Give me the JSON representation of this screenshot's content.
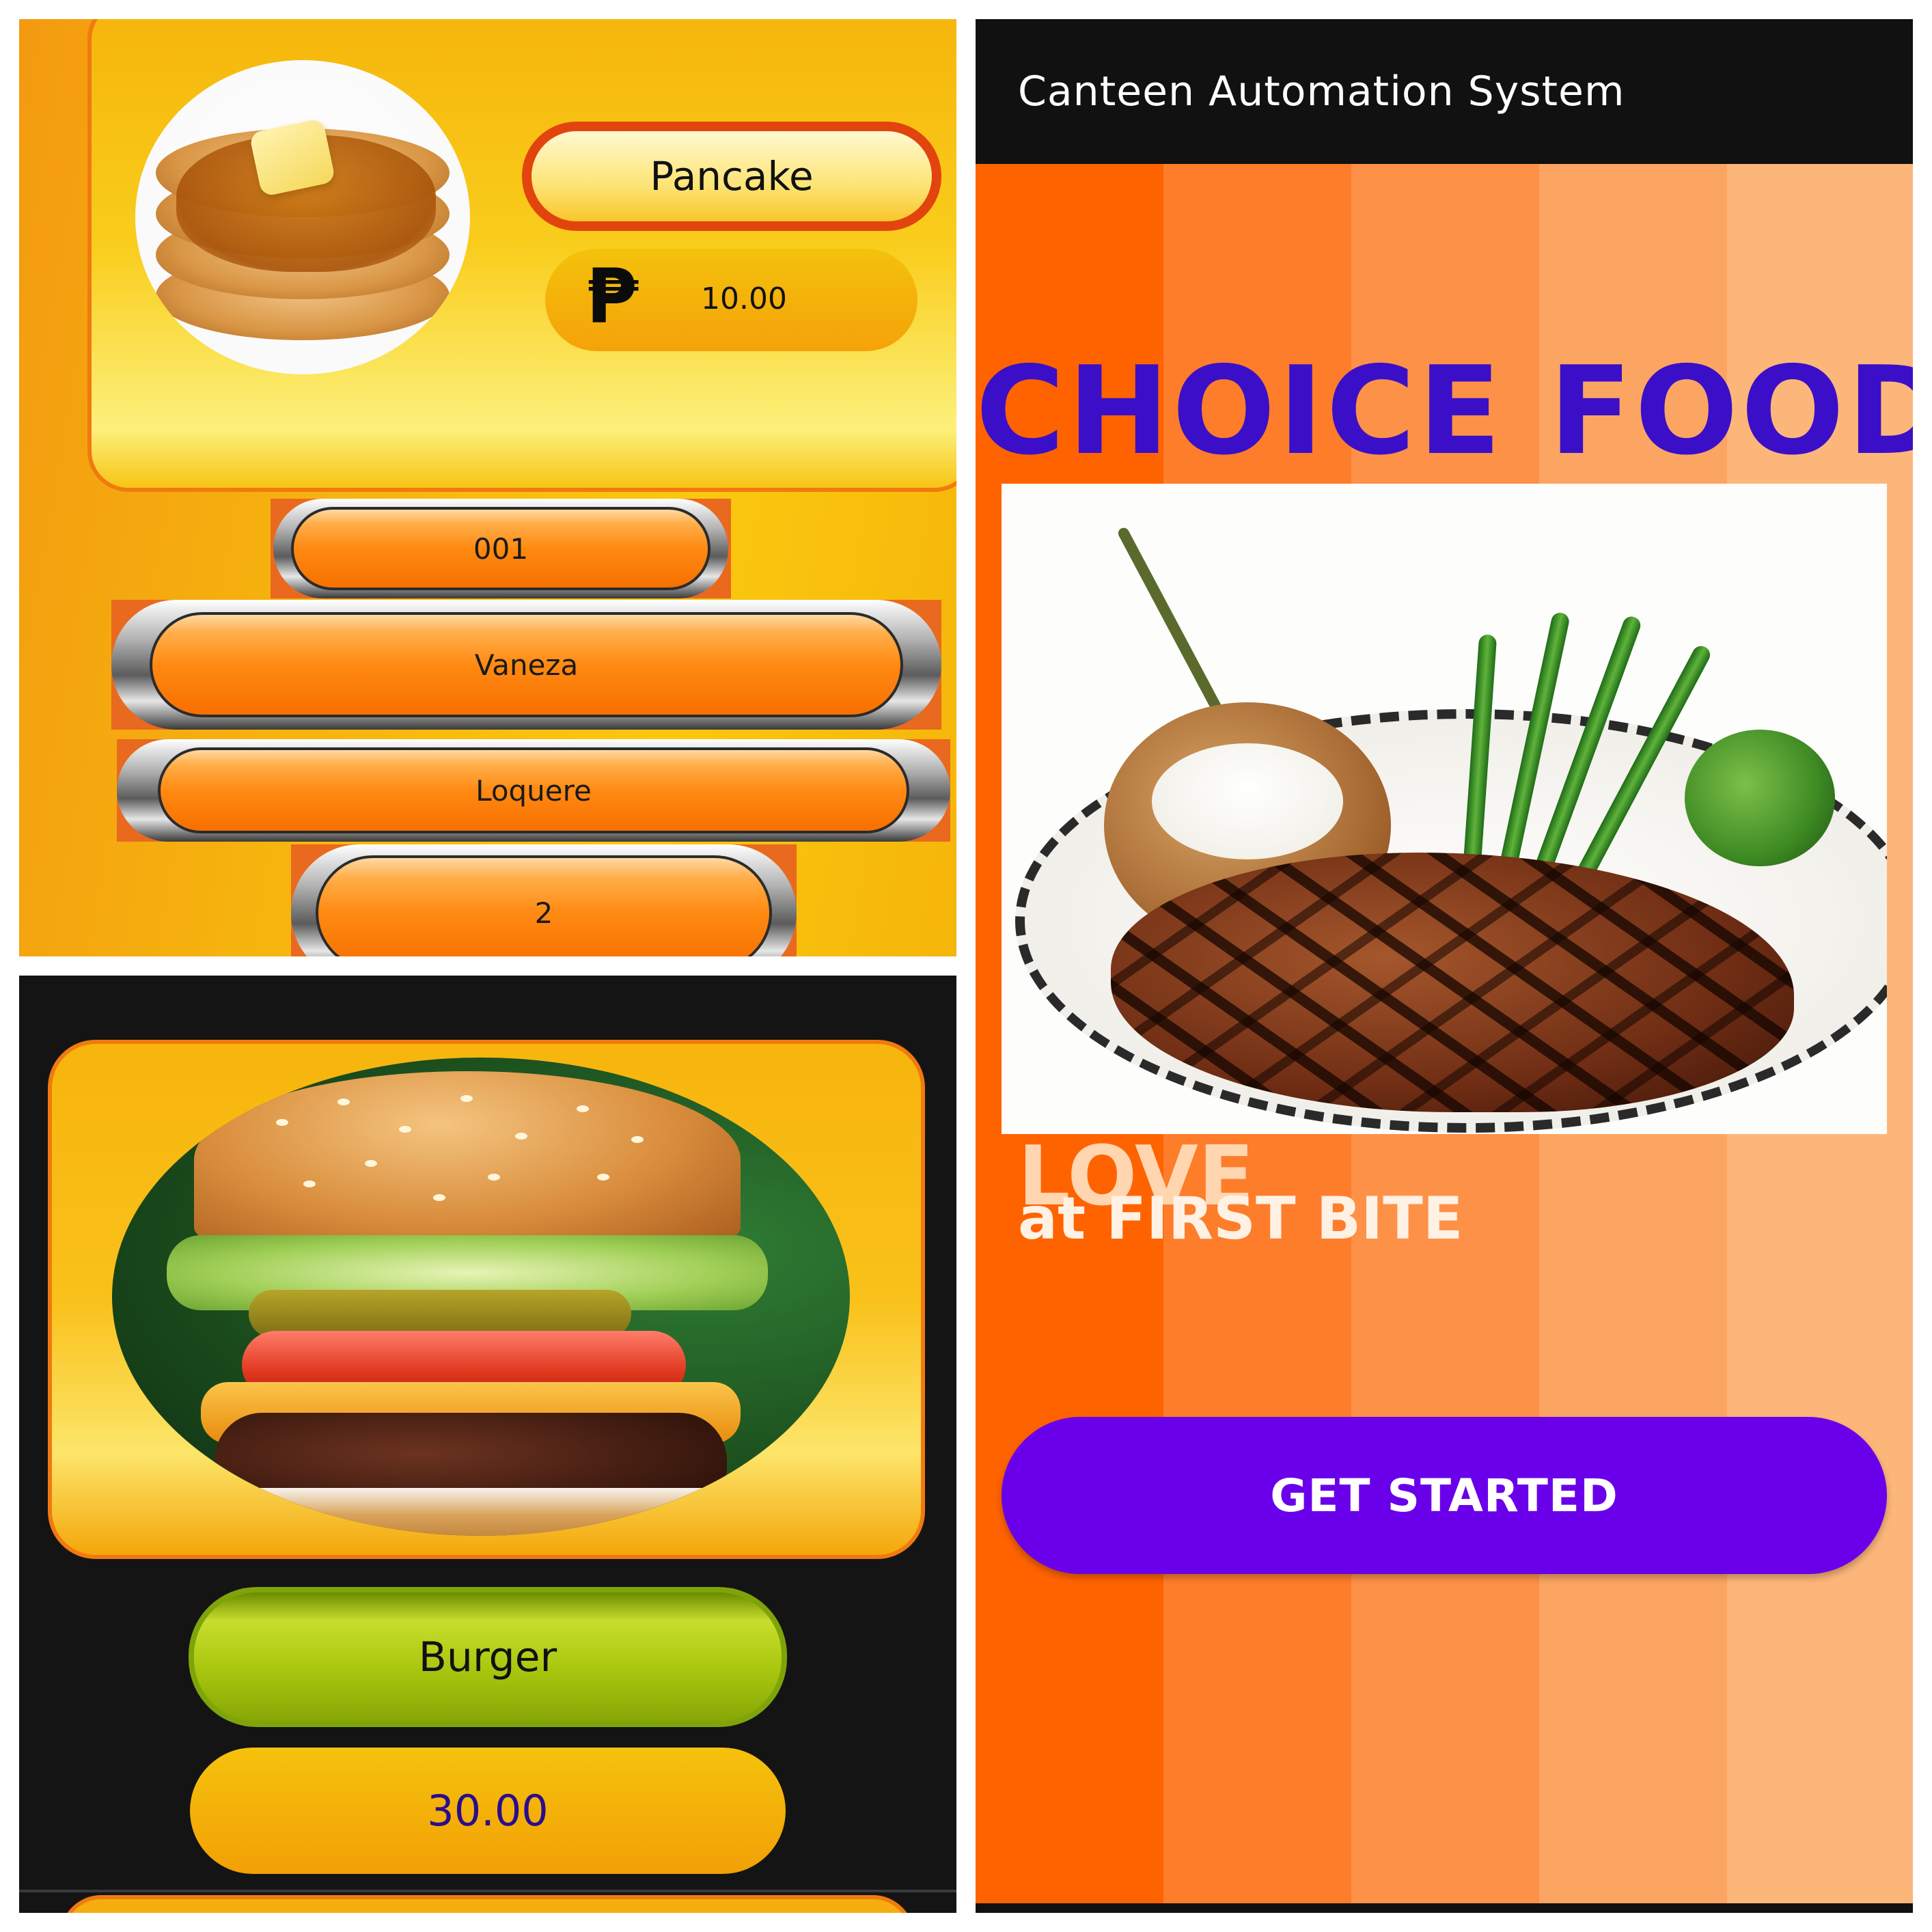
{
  "pancake_screen": {
    "food_name": "Pancake",
    "currency_symbol": "₱",
    "price": "10.00",
    "fields": [
      "001",
      "Vaneza",
      "Loquere",
      "2"
    ]
  },
  "burger_screen": {
    "food_name": "Burger",
    "price": "30.00"
  },
  "start_screen": {
    "app_title": "Canteen Automation System",
    "headline": "CHOICE FOODS",
    "tagline_line1": "LOVE",
    "tagline_line2": "at FIRST BITE",
    "cta_label": "GET STARTED",
    "stripe_colors": [
      "#ff6300",
      "#fe7d2b",
      "#fd9148",
      "#fca563",
      "#fdb67a"
    ],
    "accent_color": "#6a00ea",
    "headline_color": "#3b0fc7"
  }
}
